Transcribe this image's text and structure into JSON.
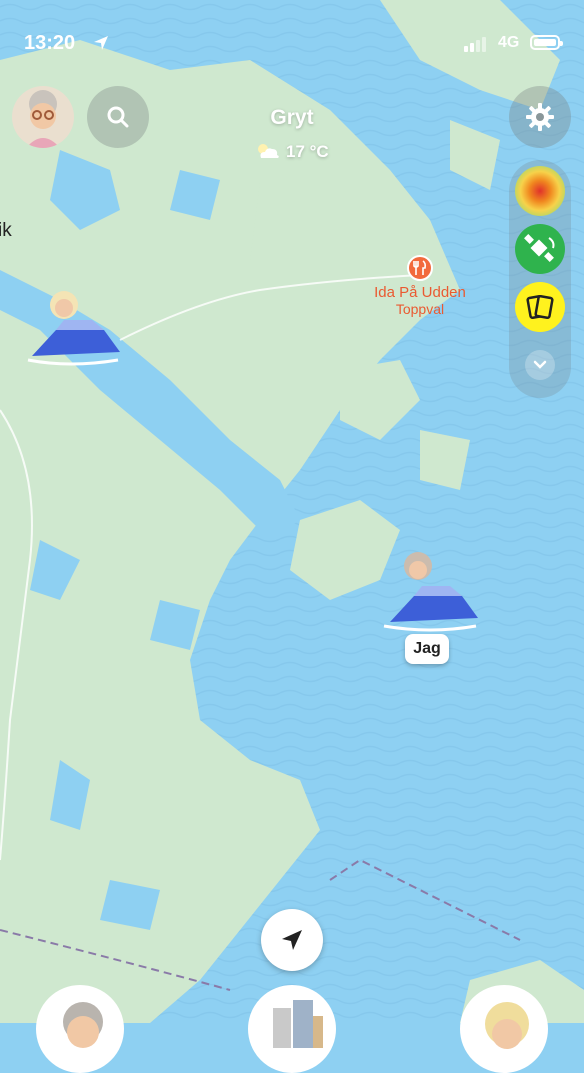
{
  "status_bar": {
    "time": "13:20",
    "network": "4G"
  },
  "header": {
    "place": "Gryt",
    "weather": "17 °C"
  },
  "map_labels": {
    "edge_label": "ik",
    "poi_name": "Ida På Udden",
    "poi_subtitle": "Toppval",
    "me_label": "Jag"
  },
  "icons": [
    "location-arrow-icon",
    "signal-icon",
    "battery-icon",
    "avatar",
    "search-icon",
    "gear-icon",
    "heatmap-icon",
    "satellite-icon",
    "cards-icon",
    "chevron-down-icon",
    "restaurant-icon",
    "navigate-icon"
  ],
  "colors": {
    "water": "#8ed0f2",
    "land": "#cfe8cf",
    "poi": "#ea5a31",
    "satellite_button": "#2fb34d",
    "cards_button": "#fff21e"
  }
}
